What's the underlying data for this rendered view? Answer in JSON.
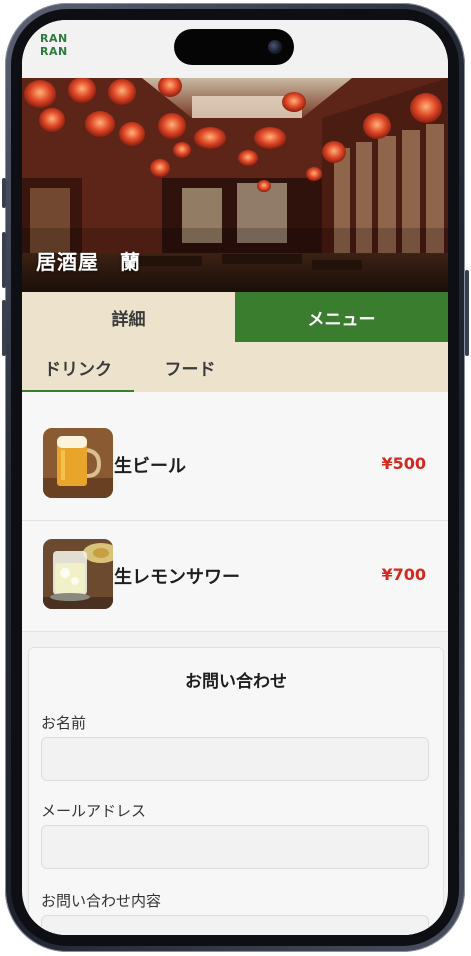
{
  "app": {
    "logo_line1": "RAN",
    "logo_line2": "RAN",
    "brand_color": "#2f7a3d"
  },
  "hero": {
    "title": "居酒屋　蘭"
  },
  "tabs": [
    {
      "label": "詳細",
      "active": false
    },
    {
      "label": "メニュー",
      "active": true
    }
  ],
  "subtabs": [
    {
      "label": "ドリンク",
      "active": true
    },
    {
      "label": "フード",
      "active": false
    }
  ],
  "menu_items": [
    {
      "name": "生ビール",
      "price": "¥500",
      "image": "beer-photo"
    },
    {
      "name": "生レモンサワー",
      "price": "¥700",
      "image": "lemon-sour-photo"
    }
  ],
  "contact": {
    "title": "お問い合わせ",
    "fields": [
      {
        "label": "お名前",
        "value": ""
      },
      {
        "label": "メールアドレス",
        "value": ""
      },
      {
        "label": "お問い合わせ内容",
        "value": ""
      }
    ]
  },
  "colors": {
    "accent_green": "#3b7d2e",
    "beige": "#ede3cc",
    "price_red": "#d32a20"
  }
}
